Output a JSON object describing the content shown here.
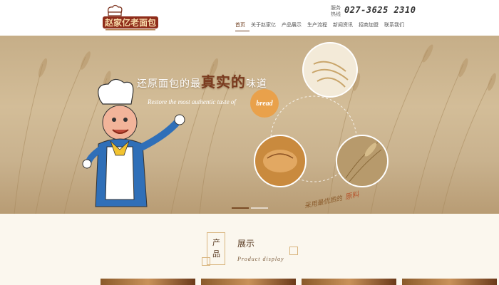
{
  "header": {
    "logo_text": "赵家亿老面包",
    "hotline_label": "服务热线",
    "hotline_number": "027-3625 2310",
    "nav": [
      "首页",
      "关于赵家亿",
      "产品展示",
      "生产流程",
      "新闻资讯",
      "招商加盟",
      "联系我们"
    ],
    "active_nav": "首页"
  },
  "banner": {
    "headline_pre": "还原面包的最",
    "headline_big": "真实的",
    "headline_post": "味道",
    "subtitle": "Restore the most authentic taste of",
    "badge": "bread",
    "caption": "采用最优质的",
    "caption_accent": "原料",
    "slides": 2,
    "active_slide": 0
  },
  "section": {
    "title_char1": "产",
    "title_char2": "品",
    "title": "展示",
    "subtitle": "Product display"
  },
  "colors": {
    "brand_brown": "#6b3a1a",
    "accent_orange": "#e9a14b",
    "gold_line": "#d9b57e"
  }
}
